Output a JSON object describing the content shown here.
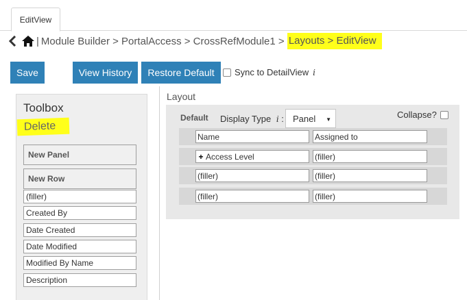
{
  "tab": {
    "label": "EditView"
  },
  "breadcrumb": {
    "separator": "|",
    "path": "Module Builder > PortalAccess > CrossRefModule1 > ",
    "highlight": "Layouts > EditView"
  },
  "toolbar": {
    "save": "Save",
    "view_history": "View History",
    "restore_default": "Restore Default",
    "sync_label": "Sync to DetailView",
    "info": "i"
  },
  "toolbox": {
    "title": "Toolbox",
    "delete": "Delete",
    "new_panel": "New Panel",
    "new_row": "New Row",
    "fields": [
      "(filler)",
      "Created By",
      "Date Created",
      "Date Modified",
      "Modified By Name",
      "Description"
    ]
  },
  "layout": {
    "title": "Layout",
    "panel": {
      "name": "Default",
      "display_type_label": "Display Type",
      "info": "i",
      "colon": ":",
      "display_type_value": "Panel",
      "collapse_label": "Collapse?"
    },
    "rows": [
      [
        "Name",
        "Assigned to"
      ],
      [
        "Access Level",
        "(filler)"
      ],
      [
        "(filler)",
        "(filler)"
      ],
      [
        "(filler)",
        "(filler)"
      ]
    ]
  },
  "colors": {
    "button": "#2f81b7",
    "highlight": "#ffff1a"
  }
}
